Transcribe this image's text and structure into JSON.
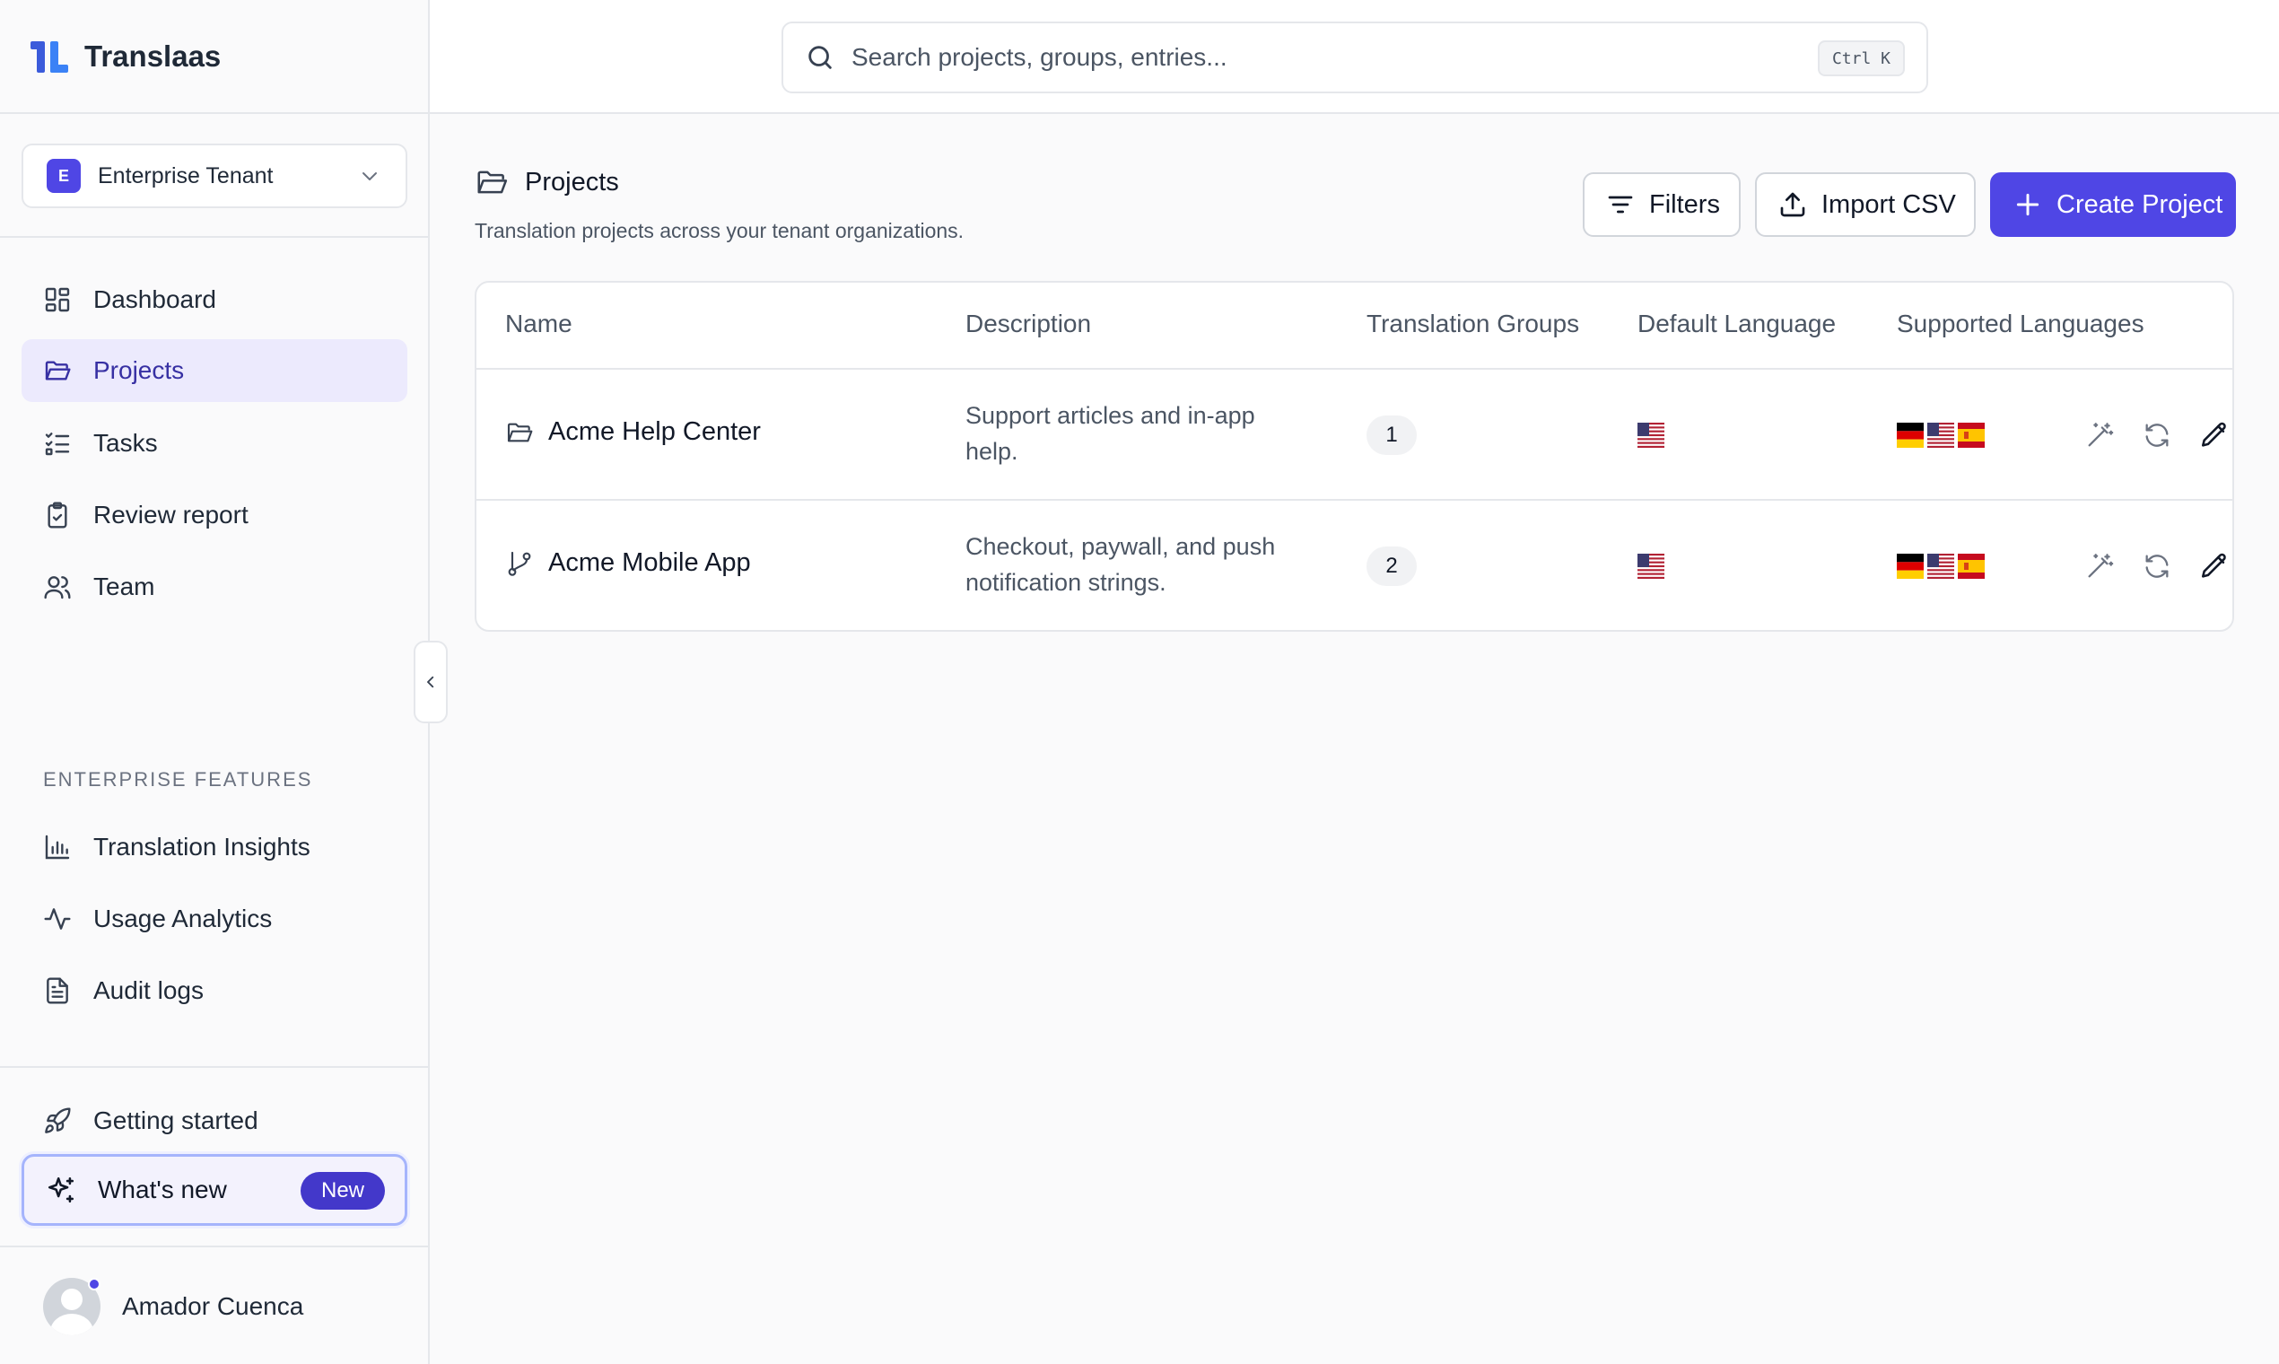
{
  "brand": {
    "name": "Translaas"
  },
  "tenant": {
    "badge": "E",
    "name": "Enterprise Tenant"
  },
  "nav": {
    "items": [
      {
        "label": "Dashboard"
      },
      {
        "label": "Projects"
      },
      {
        "label": "Tasks"
      },
      {
        "label": "Review report"
      },
      {
        "label": "Team"
      }
    ],
    "section_label": "ENTERPRISE FEATURES",
    "enterprise_items": [
      {
        "label": "Translation Insights"
      },
      {
        "label": "Usage Analytics"
      },
      {
        "label": "Audit logs"
      }
    ],
    "getting_started": "Getting started",
    "whats_new": "What's new",
    "new_badge": "New"
  },
  "user": {
    "name": "Amador Cuenca"
  },
  "search": {
    "placeholder": "Search projects, groups, entries...",
    "shortcut": "Ctrl K"
  },
  "page": {
    "title": "Projects",
    "subtitle": "Translation projects across your tenant organizations."
  },
  "actions": {
    "filters": "Filters",
    "import": "Import CSV",
    "create": "Create Project"
  },
  "table": {
    "columns": [
      "Name",
      "Description",
      "Translation Groups",
      "Default Language",
      "Supported Languages"
    ],
    "rows": [
      {
        "name": "Acme Help Center",
        "icon": "folder-icon",
        "description": [
          "Support articles and in-app",
          "help."
        ],
        "groups": "1",
        "default_language": "us",
        "supported_languages": [
          "de",
          "us",
          "es"
        ]
      },
      {
        "name": "Acme Mobile App",
        "icon": "git-branch-icon",
        "description": [
          "Checkout, paywall, and push",
          "notification strings."
        ],
        "groups": "2",
        "default_language": "us",
        "supported_languages": [
          "de",
          "us",
          "es"
        ]
      }
    ]
  },
  "colors": {
    "accent": "#4f46e5",
    "active_bg": "#eceafd",
    "active_text": "#3730a3"
  }
}
